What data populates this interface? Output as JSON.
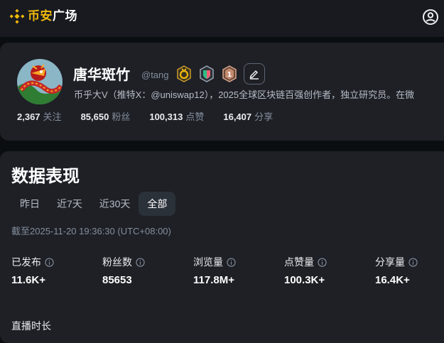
{
  "brand": {
    "name_colored": "币安",
    "name_white": "广场",
    "color": "#f0b90b"
  },
  "profile": {
    "name": "唐华斑竹",
    "handle": "@tang",
    "bio": "币乎大V（推特X：@uniswap12），2025全球区块链百强创作者，独立研究员。在微",
    "badges": [
      {
        "icon": "gold-ring-badge-icon"
      },
      {
        "icon": "shield-badge-icon"
      },
      {
        "icon": "rank-badge-icon",
        "text": "1"
      }
    ],
    "stats": [
      {
        "value": "2,367",
        "label": "关注"
      },
      {
        "value": "85,650",
        "label": "粉丝"
      },
      {
        "value": "100,313",
        "label": "点赞"
      },
      {
        "value": "16,407",
        "label": "分享"
      }
    ]
  },
  "performance": {
    "title": "数据表现",
    "tabs": [
      "昨日",
      "近7天",
      "近30天",
      "全部"
    ],
    "active_tab": "全部",
    "timestamp": "截至2025-11-20 19:36:30 (UTC+08:00)",
    "metrics": [
      {
        "label": "已发布",
        "value": "11.6K+"
      },
      {
        "label": "粉丝数",
        "value": "85653"
      },
      {
        "label": "浏览量",
        "value": "117.8M+"
      },
      {
        "label": "点赞量",
        "value": "100.3K+"
      },
      {
        "label": "分享量",
        "value": "16.4K+"
      }
    ],
    "live_label": "直播时长"
  }
}
